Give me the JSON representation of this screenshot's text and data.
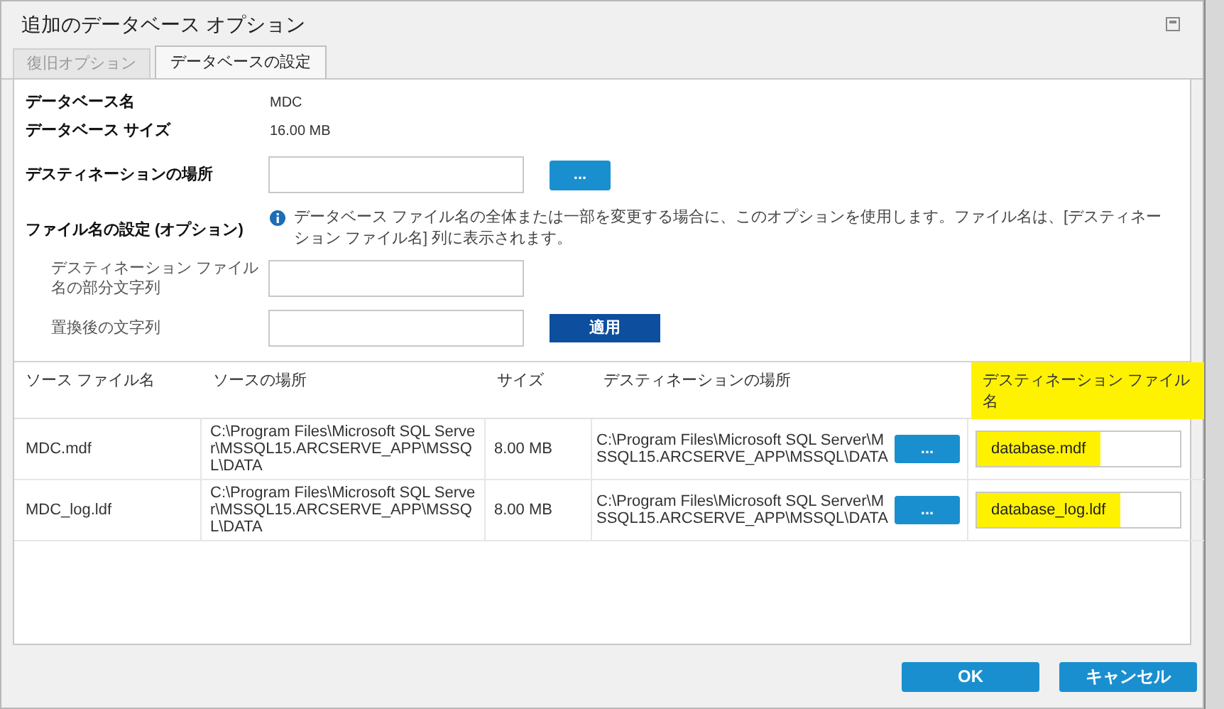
{
  "window": {
    "title": "追加のデータベース オプション"
  },
  "tabs": [
    {
      "label": "復旧オプション",
      "selected": false
    },
    {
      "label": "データベースの設定",
      "selected": true
    }
  ],
  "form": {
    "db_name_label": "データベース名",
    "db_name": "MDC",
    "db_size_label": "データベース サイズ",
    "db_size": "16.00 MB",
    "destination_label": "デスティネーションの場所",
    "browse_button": "...",
    "filename_label": "ファイル名の設定 (オプション)",
    "info": "データベース ファイル名の全体または一部を変更する場合に、このオプションを使用します。ファイル名は、[デスティネーション ファイル名] 列に表示されます。",
    "partial_label": "デスティネーション ファイル名の部分文字列",
    "replace_label": "置換後の文字列",
    "apply_button": "適用"
  },
  "table": {
    "columns": [
      {
        "label": "ソース ファイル名",
        "highlighted": false
      },
      {
        "label": "ソースの場所",
        "highlighted": false
      },
      {
        "label": "サイズ",
        "highlighted": false
      },
      {
        "label": "デスティネーションの場所",
        "highlighted": false
      },
      {
        "label": "デスティネーション ファイル名",
        "highlighted": true
      }
    ],
    "rows": [
      {
        "source_file": "MDC.mdf",
        "source_location": "C:\\Program Files\\Microsoft SQL Server\\MSSQL15.ARCSERVE_APP\\MSSQL\\DATA",
        "size": "8.00 MB",
        "destination_location": "C:\\Program Files\\Microsoft SQL Server\\MSSQL15.ARCSERVE_APP\\MSSQL\\DATA",
        "browse_button": "...",
        "destination_file": "database.mdf",
        "highlighted": true
      },
      {
        "source_file": "MDC_log.ldf",
        "source_location": "C:\\Program Files\\Microsoft SQL Server\\MSSQL15.ARCSERVE_APP\\MSSQL\\DATA",
        "size": "8.00 MB",
        "destination_location": "C:\\Program Files\\Microsoft SQL Server\\MSSQL15.ARCSERVE_APP\\MSSQL\\DATA",
        "browse_button": "...",
        "destination_file": "database_log.ldf",
        "highlighted": true
      }
    ]
  },
  "buttons": [
    {
      "label": "OK"
    },
    {
      "label": "キャンセル"
    }
  ]
}
